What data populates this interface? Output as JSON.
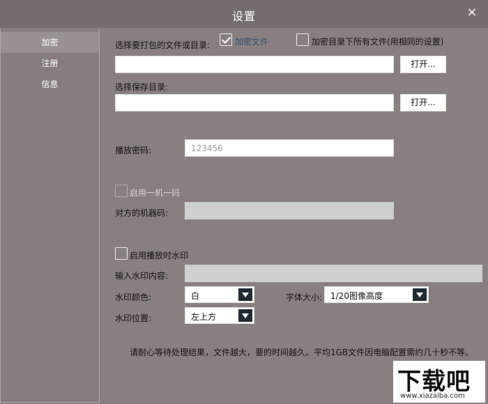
{
  "window": {
    "title": "设置",
    "close_icon": "×"
  },
  "sidebar": {
    "items": [
      {
        "label": "加密",
        "active": true
      },
      {
        "label": "注册",
        "active": false
      },
      {
        "label": "信息",
        "active": false
      }
    ]
  },
  "encrypt": {
    "select_label": "选择要打包的文件或目录:",
    "encrypt_file_label": "加密文件",
    "encrypt_file_checked": true,
    "encrypt_all_label": "加密目录下所有文件(用相同的设置)",
    "encrypt_all_checked": false,
    "source_path": "",
    "open_button": "打开...",
    "save_label": "选择保存目录:",
    "save_path": "",
    "open_button2": "打开...",
    "password_label": "播放密码:",
    "password_placeholder": "123456",
    "one_machine_label": "启用一机一码",
    "one_machine_checked": false,
    "machine_code_label": "对方的机器码:",
    "machine_code": "",
    "watermark_label": "启用播放时水印",
    "watermark_checked": false,
    "watermark_content_label": "输入水印内容:",
    "watermark_content": "",
    "color_label": "水印颜色:",
    "color_value": "白",
    "font_size_label": "字体大小:",
    "font_size_value": "1/20图像高度",
    "position_label": "水印位置:",
    "position_value": "左上方",
    "note": "请耐心等待处理结果，文件越大，要的时间越久。平均1GB文件因电脑配置需约几十秒不等。"
  },
  "watermark_logo": {
    "big": "下载吧",
    "small": "www.xiazaiba.com"
  }
}
